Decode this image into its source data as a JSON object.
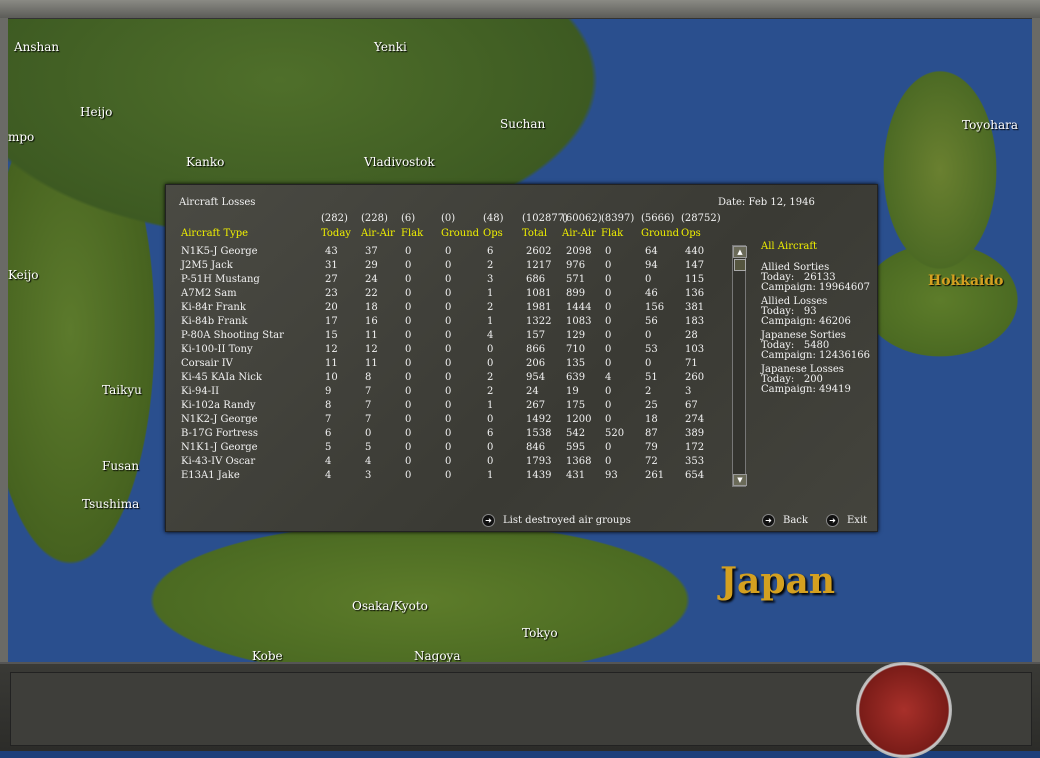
{
  "map": {
    "labels": [
      "Anshan",
      "Yenki",
      "Suchan",
      "Vladivostok",
      "Kanko",
      "Heijo",
      "mpo",
      "Keijo",
      "Taikyu",
      "Fusan",
      "Tsushima",
      "Toyohara",
      "Osaka/Kyoto",
      "Tokyo",
      "Kobe",
      "Nagoya"
    ],
    "region_big": "Japan",
    "region_hokkaido": "Hokkaido"
  },
  "dialog": {
    "title": "Aircraft Losses",
    "date": "Date: Feb 12, 1946",
    "type_header": "Aircraft Type",
    "columns": [
      {
        "label": "Today",
        "total": "(282)"
      },
      {
        "label": "Air-Air",
        "total": "(228)"
      },
      {
        "label": "Flak",
        "total": "(6)"
      },
      {
        "label": "Ground",
        "total": "(0)"
      },
      {
        "label": "Ops",
        "total": "(48)"
      },
      {
        "label": "Total",
        "total": "(102877)"
      },
      {
        "label": "Air-Air",
        "total": "(60062)"
      },
      {
        "label": "Flak",
        "total": "(8397)"
      },
      {
        "label": "Ground",
        "total": "(5666)"
      },
      {
        "label": "Ops",
        "total": "(28752)"
      }
    ],
    "rows": [
      [
        "N1K5-J George",
        "43",
        "37",
        "0",
        "0",
        "6",
        "2602",
        "2098",
        "0",
        "64",
        "440"
      ],
      [
        "J2M5 Jack",
        "31",
        "29",
        "0",
        "0",
        "2",
        "1217",
        "976",
        "0",
        "94",
        "147"
      ],
      [
        "P-51H Mustang",
        "27",
        "24",
        "0",
        "0",
        "3",
        "686",
        "571",
        "0",
        "0",
        "115"
      ],
      [
        "A7M2 Sam",
        "23",
        "22",
        "0",
        "0",
        "1",
        "1081",
        "899",
        "0",
        "46",
        "136"
      ],
      [
        "Ki-84r Frank",
        "20",
        "18",
        "0",
        "0",
        "2",
        "1981",
        "1444",
        "0",
        "156",
        "381"
      ],
      [
        "Ki-84b Frank",
        "17",
        "16",
        "0",
        "0",
        "1",
        "1322",
        "1083",
        "0",
        "56",
        "183"
      ],
      [
        "P-80A Shooting Star",
        "15",
        "11",
        "0",
        "0",
        "4",
        "157",
        "129",
        "0",
        "0",
        "28"
      ],
      [
        "Ki-100-II Tony",
        "12",
        "12",
        "0",
        "0",
        "0",
        "866",
        "710",
        "0",
        "53",
        "103"
      ],
      [
        "Corsair IV",
        "11",
        "11",
        "0",
        "0",
        "0",
        "206",
        "135",
        "0",
        "0",
        "71"
      ],
      [
        "Ki-45 KAIa Nick",
        "10",
        "8",
        "0",
        "0",
        "2",
        "954",
        "639",
        "4",
        "51",
        "260"
      ],
      [
        "Ki-94-II",
        "9",
        "7",
        "0",
        "0",
        "2",
        "24",
        "19",
        "0",
        "2",
        "3"
      ],
      [
        "Ki-102a Randy",
        "8",
        "7",
        "0",
        "0",
        "1",
        "267",
        "175",
        "0",
        "25",
        "67"
      ],
      [
        "N1K2-J George",
        "7",
        "7",
        "0",
        "0",
        "0",
        "1492",
        "1200",
        "0",
        "18",
        "274"
      ],
      [
        "B-17G Fortress",
        "6",
        "0",
        "0",
        "0",
        "6",
        "1538",
        "542",
        "520",
        "87",
        "389"
      ],
      [
        "N1K1-J George",
        "5",
        "5",
        "0",
        "0",
        "0",
        "846",
        "595",
        "0",
        "79",
        "172"
      ],
      [
        "Ki-43-IV Oscar",
        "4",
        "4",
        "0",
        "0",
        "0",
        "1793",
        "1368",
        "0",
        "72",
        "353"
      ],
      [
        "E13A1 Jake",
        "4",
        "3",
        "0",
        "0",
        "1",
        "1439",
        "431",
        "93",
        "261",
        "654"
      ]
    ],
    "filter": "All Aircraft",
    "stats": [
      {
        "title": "Allied Sorties",
        "today": "Today:   26133",
        "campaign": "Campaign: 19964607"
      },
      {
        "title": "Allied Losses",
        "today": "Today:   93",
        "campaign": "Campaign: 46206"
      },
      {
        "title": "Japanese Sorties",
        "today": "Today:   5480",
        "campaign": "Campaign: 12436166"
      },
      {
        "title": "Japanese Losses",
        "today": "Today:   200",
        "campaign": "Campaign: 49419"
      }
    ],
    "list_destroyed": "List destroyed air groups",
    "back": "Back",
    "exit": "Exit"
  }
}
